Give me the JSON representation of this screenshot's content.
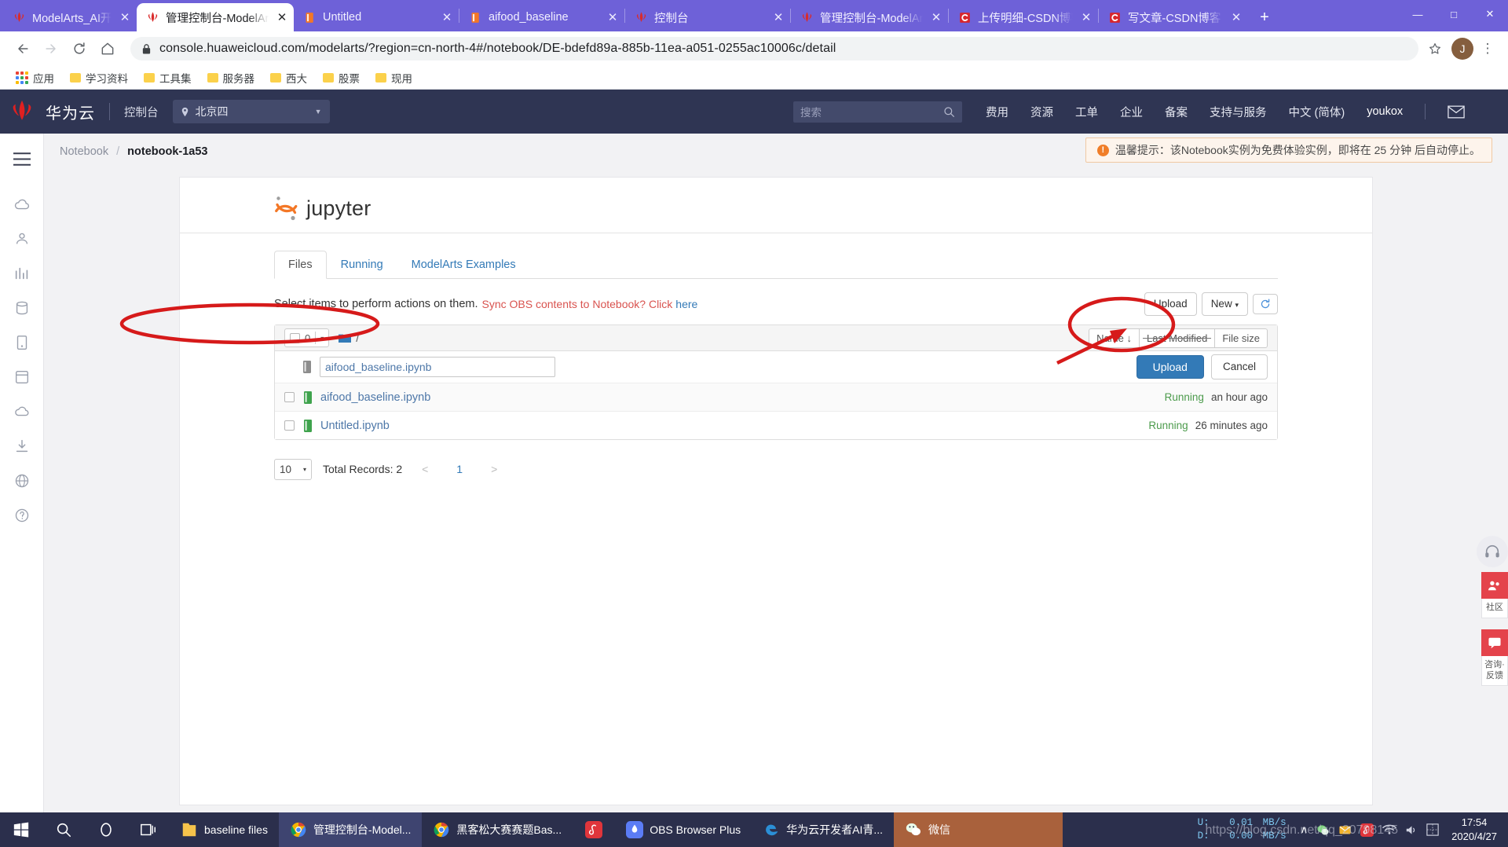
{
  "browser": {
    "tabs": [
      {
        "title": "ModelArts_AI开发平台",
        "icon": "huawei-flower-icon",
        "active": false,
        "closable": true
      },
      {
        "title": "管理控制台-ModelArts",
        "icon": "huawei-flower-icon",
        "active": true,
        "closable": true
      },
      {
        "title": "Untitled",
        "icon": "jupyter-book-icon",
        "active": false,
        "closable": true
      },
      {
        "title": "aifood_baseline",
        "icon": "jupyter-book-icon",
        "active": false,
        "closable": true
      },
      {
        "title": "控制台",
        "icon": "huawei-flower-icon",
        "active": false,
        "closable": true
      },
      {
        "title": "管理控制台-ModelArts",
        "icon": "huawei-flower-icon",
        "active": false,
        "closable": true
      },
      {
        "title": "上传明细-CSDN博客",
        "icon": "csdn-icon",
        "active": false,
        "closable": true
      },
      {
        "title": "写文章-CSDN博客",
        "icon": "csdn-icon",
        "active": false,
        "closable": true
      }
    ],
    "new_tab_label": "+",
    "window_controls": {
      "minimize": "—",
      "maximize": "□",
      "close": "✕"
    },
    "url": "console.huaweicloud.com/modelarts/?region=cn-north-4#/notebook/DE-bdefd89a-885b-11ea-a051-0255ac10006c/detail",
    "profile_initial": "J",
    "bookmarks": [
      {
        "label": "应用",
        "icon": "apps-grid-icon"
      },
      {
        "label": "学习资料",
        "icon": "folder-icon"
      },
      {
        "label": "工具集",
        "icon": "folder-icon"
      },
      {
        "label": "服务器",
        "icon": "folder-icon"
      },
      {
        "label": "西大",
        "icon": "folder-icon"
      },
      {
        "label": "股票",
        "icon": "folder-icon"
      },
      {
        "label": "现用",
        "icon": "folder-icon"
      }
    ]
  },
  "hw_header": {
    "brand": "华为云",
    "console": "控制台",
    "region": "北京四",
    "search_placeholder": "搜索",
    "nav": [
      "费用",
      "资源",
      "工单",
      "企业",
      "备案",
      "支持与服务",
      "中文 (简体)"
    ],
    "user": "youkox",
    "mail_icon": "mail-icon"
  },
  "breadcrumb": {
    "root": "Notebook",
    "sep": "/",
    "current": "notebook-1a53"
  },
  "warning": {
    "text": "温馨提示：该Notebook实例为免费体验实例，即将在 25 分钟 后自动停止。",
    "accent": "#f07d28"
  },
  "jupyter": {
    "logo_text": "jupyter",
    "tabs": [
      {
        "label": "Files",
        "active": true
      },
      {
        "label": "Running",
        "active": false
      },
      {
        "label": "ModelArts Examples",
        "active": false
      }
    ],
    "action_line": {
      "text": "Select items to perform actions on them.",
      "red_text": "Sync OBS contents to Notebook? Click",
      "link_text": "here"
    },
    "buttons": {
      "upload": "Upload",
      "new": "New",
      "new_caret": "▾",
      "refresh_icon": "refresh-icon"
    },
    "filebox": {
      "select_count": "0",
      "select_caret": "▾",
      "path": "/",
      "sort_buttons": [
        {
          "label": "Name",
          "arrow": "↓",
          "struck": false
        },
        {
          "label": "Last Modified",
          "arrow": "",
          "struck": true
        },
        {
          "label": "File size",
          "arrow": "",
          "struck": false
        }
      ],
      "upload_row": {
        "filename_value": "aifood_baseline.ipynb",
        "upload_label": "Upload",
        "cancel_label": "Cancel",
        "icon": "notebook-upload-icon"
      },
      "rows": [
        {
          "name": "aifood_baseline.ipynb",
          "status": "Running",
          "time": "an hour ago",
          "icon": "notebook-green-icon"
        },
        {
          "name": "Untitled.ipynb",
          "status": "Running",
          "time": "26 minutes ago",
          "icon": "notebook-green-icon"
        }
      ]
    },
    "pager": {
      "per_page": "10",
      "per_page_caret": "▾",
      "total": "Total Records: 2",
      "prev": "<",
      "page": "1",
      "next": ">"
    }
  },
  "right_dock": {
    "round_icon": "headset-icon",
    "blocks": [
      {
        "icon": "community-icon",
        "label": "社区"
      },
      {
        "icon": "feedback-icon",
        "label": "咨询·反馈"
      }
    ]
  },
  "taskbar": {
    "start_icon": "windows-start-icon",
    "search_icon": "search-icon",
    "cortana_icon": "cortana-circle-icon",
    "taskview_icon": "task-view-icon",
    "items": [
      {
        "label": "baseline files",
        "icon": "folder-icon",
        "active": false
      },
      {
        "label": "管理控制台-Model...",
        "icon": "chrome-icon",
        "active": true
      },
      {
        "label": "黑客松大赛赛题Bas...",
        "icon": "chrome-icon",
        "active": false
      },
      {
        "label": "",
        "icon": "netease-music-icon",
        "active": false
      },
      {
        "label": "OBS Browser Plus",
        "icon": "obs-icon",
        "active": false
      },
      {
        "label": "华为云开发者AI青...",
        "icon": "edge-icon",
        "active": false
      },
      {
        "label": "微信",
        "icon": "wechat-icon",
        "active": false
      }
    ],
    "network": {
      "up_label": "U:",
      "up_value": "0.01",
      "up_unit": "MB/s",
      "down_label": "D:",
      "down_value": "0.00",
      "down_unit": "MB/s"
    },
    "tray_caret": "∧",
    "tray_icons": [
      "wechat-tray-icon",
      "mail-tray-icon",
      "netease-tray-icon",
      "wifi-icon",
      "volume-icon",
      "ime-icon"
    ],
    "clock": {
      "time": "17:54",
      "date": "2020/4/27"
    },
    "watermark": "https://blog.csdn.net/qq_20798145"
  }
}
